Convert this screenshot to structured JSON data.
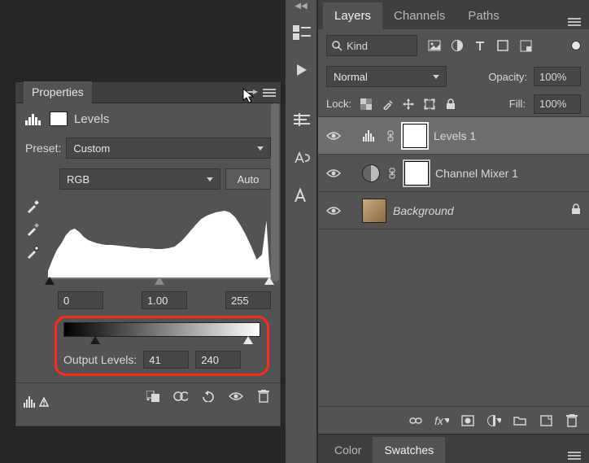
{
  "properties": {
    "panel_title": "Properties",
    "adjustment_title": "Levels",
    "preset_label": "Preset:",
    "preset_value": "Custom",
    "channel_value": "RGB",
    "auto_label": "Auto",
    "input_shadow": "0",
    "input_mid": "1.00",
    "input_highlight": "255",
    "output_label": "Output Levels:",
    "output_shadow": "41",
    "output_highlight": "240"
  },
  "layers_panel": {
    "tabs": [
      "Layers",
      "Channels",
      "Paths"
    ],
    "active_tab": 0,
    "filter_kind": "Kind",
    "blend_mode": "Normal",
    "opacity_label": "Opacity:",
    "opacity_value": "100%",
    "lock_label": "Lock:",
    "fill_label": "Fill:",
    "fill_value": "100%",
    "layers": [
      {
        "name": "Levels 1",
        "type": "levels",
        "visible": true,
        "selected": true
      },
      {
        "name": "Channel Mixer 1",
        "type": "channelmixer",
        "visible": true,
        "selected": false
      },
      {
        "name": "Background",
        "type": "image",
        "visible": true,
        "locked": true,
        "italic": true
      }
    ]
  },
  "color_swatches": {
    "tabs": [
      "Color",
      "Swatches"
    ],
    "active_tab": 1
  }
}
